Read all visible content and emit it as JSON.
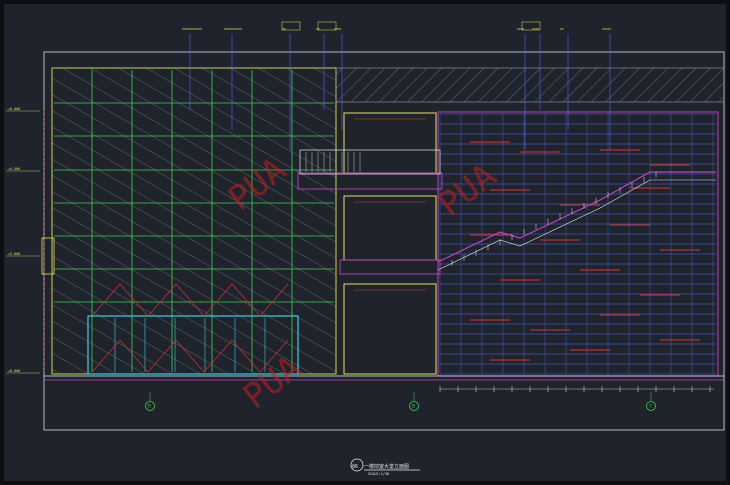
{
  "drawing": {
    "title": "一楼前室大堂立面图",
    "scale": "SCALE:1/30",
    "number": "06"
  },
  "grid_axes": [
    "R",
    "B",
    "T"
  ],
  "callouts_top": [
    {
      "text": "XXXXXXXXXXX"
    },
    {
      "text": "XXXXXXXXXX"
    },
    {
      "text": "XX"
    },
    {
      "text": "XX"
    },
    {
      "text": "XXXX"
    },
    {
      "text": "XXXX"
    },
    {
      "text": "XXXX"
    },
    {
      "text": "XX"
    },
    {
      "text": "XXXXX"
    }
  ],
  "elevation_marks": [
    {
      "text": "+6.000"
    },
    {
      "text": "+4.500"
    },
    {
      "text": "+3.000"
    },
    {
      "text": "+0.000"
    }
  ],
  "watermarks": [
    "PUA",
    "PUA",
    "PUA"
  ],
  "colors": {
    "background": "#1f242c",
    "frame": "#d8dce4",
    "yellow": "#e6e05a",
    "green": "#3fcf4f",
    "magenta": "#c040c0",
    "blue": "#4a6cf0",
    "red": "#e0302a",
    "cyan": "#35d0e6",
    "white": "#e8e8e8",
    "watermark": "#c81e1e"
  }
}
